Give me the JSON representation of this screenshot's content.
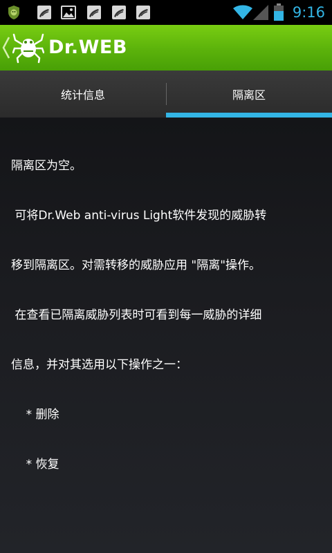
{
  "status_bar": {
    "time": "9:16",
    "accent_color": "#33b5e5",
    "left_icons": [
      "shield-notification-icon",
      "image-notification-icon",
      "gallery-notification-icon",
      "image-notification-icon",
      "image-notification-icon"
    ],
    "right_icons": [
      "wifi-icon",
      "signal-icon",
      "battery-icon"
    ]
  },
  "action_bar": {
    "title": "Dr.WEB",
    "brand_color": "#5bb20b"
  },
  "tabs": [
    {
      "label": "统计信息",
      "selected": false
    },
    {
      "label": "隔离区",
      "selected": true
    }
  ],
  "content": {
    "lines": [
      "隔离区为空。",
      " 可将Dr.Web anti-virus Light软件发现的威胁转",
      "移到隔离区。对需转移的威胁应用 \"隔离\"操作。",
      " 在查看已隔离威胁列表时可看到每一威胁的详细",
      "信息，并对其选用以下操作之一：",
      "    * 删除",
      "    * 恢复"
    ]
  }
}
